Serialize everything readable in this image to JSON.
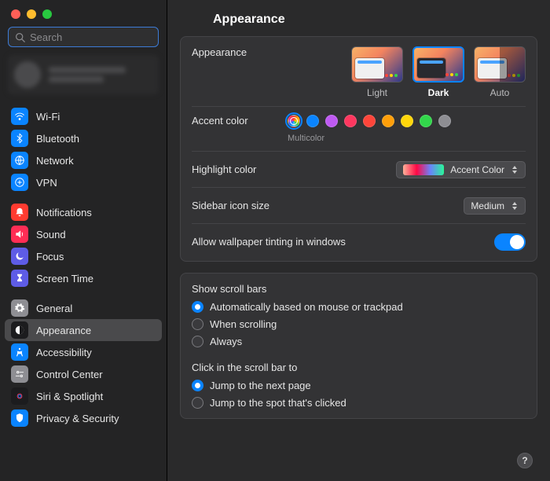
{
  "search": {
    "placeholder": "Search"
  },
  "page": {
    "title": "Appearance"
  },
  "sidebar": {
    "groups": [
      {
        "items": [
          {
            "id": "wifi",
            "label": "Wi-Fi",
            "bg": "#0a84ff",
            "glyph": "wifi"
          },
          {
            "id": "bluetooth",
            "label": "Bluetooth",
            "bg": "#0a84ff",
            "glyph": "bt"
          },
          {
            "id": "network",
            "label": "Network",
            "bg": "#0a84ff",
            "glyph": "globe"
          },
          {
            "id": "vpn",
            "label": "VPN",
            "bg": "#0a84ff",
            "glyph": "vpn"
          }
        ]
      },
      {
        "items": [
          {
            "id": "notifications",
            "label": "Notifications",
            "bg": "#ff3b30",
            "glyph": "bell"
          },
          {
            "id": "sound",
            "label": "Sound",
            "bg": "#ff2d55",
            "glyph": "sound"
          },
          {
            "id": "focus",
            "label": "Focus",
            "bg": "#5e5ce6",
            "glyph": "moon"
          },
          {
            "id": "screentime",
            "label": "Screen Time",
            "bg": "#5e5ce6",
            "glyph": "hourglass"
          }
        ]
      },
      {
        "items": [
          {
            "id": "general",
            "label": "General",
            "bg": "#8e8e93",
            "glyph": "gear"
          },
          {
            "id": "appearance",
            "label": "Appearance",
            "bg": "#1c1c1e",
            "glyph": "appearance",
            "selected": true
          },
          {
            "id": "accessibility",
            "label": "Accessibility",
            "bg": "#0a84ff",
            "glyph": "access"
          },
          {
            "id": "controlcenter",
            "label": "Control Center",
            "bg": "#8e8e93",
            "glyph": "cc"
          },
          {
            "id": "siri",
            "label": "Siri & Spotlight",
            "bg": "#1c1c1e",
            "glyph": "siri"
          },
          {
            "id": "privacy",
            "label": "Privacy & Security",
            "bg": "#0a84ff",
            "glyph": "hand"
          }
        ]
      }
    ]
  },
  "appearance": {
    "label": "Appearance",
    "options": [
      {
        "id": "light",
        "label": "Light",
        "selected": false,
        "dark": false,
        "half": false
      },
      {
        "id": "dark",
        "label": "Dark",
        "selected": true,
        "dark": true,
        "half": false
      },
      {
        "id": "auto",
        "label": "Auto",
        "selected": false,
        "dark": false,
        "half": true
      }
    ]
  },
  "accent": {
    "label": "Accent color",
    "selected_name": "Multicolor",
    "colors": [
      {
        "id": "multicolor",
        "hex": "multi",
        "selected": true
      },
      {
        "id": "blue",
        "hex": "#0a84ff"
      },
      {
        "id": "purple",
        "hex": "#bf5af2"
      },
      {
        "id": "pink",
        "hex": "#ff375f"
      },
      {
        "id": "red",
        "hex": "#ff453a"
      },
      {
        "id": "orange",
        "hex": "#ff9f0a"
      },
      {
        "id": "yellow",
        "hex": "#ffd60a"
      },
      {
        "id": "green",
        "hex": "#32d74b"
      },
      {
        "id": "graphite",
        "hex": "#8e8e93"
      }
    ]
  },
  "highlight": {
    "label": "Highlight color",
    "value": "Accent Color"
  },
  "sidebar_icon": {
    "label": "Sidebar icon size",
    "value": "Medium"
  },
  "wallpaper_tint": {
    "label": "Allow wallpaper tinting in windows",
    "on": true
  },
  "scrollbars": {
    "show_label": "Show scroll bars",
    "show_options": [
      {
        "id": "auto",
        "label": "Automatically based on mouse or trackpad",
        "checked": true
      },
      {
        "id": "when",
        "label": "When scrolling",
        "checked": false
      },
      {
        "id": "always",
        "label": "Always",
        "checked": false
      }
    ],
    "click_label": "Click in the scroll bar to",
    "click_options": [
      {
        "id": "page",
        "label": "Jump to the next page",
        "checked": true
      },
      {
        "id": "spot",
        "label": "Jump to the spot that's clicked",
        "checked": false
      }
    ]
  },
  "help": "?"
}
